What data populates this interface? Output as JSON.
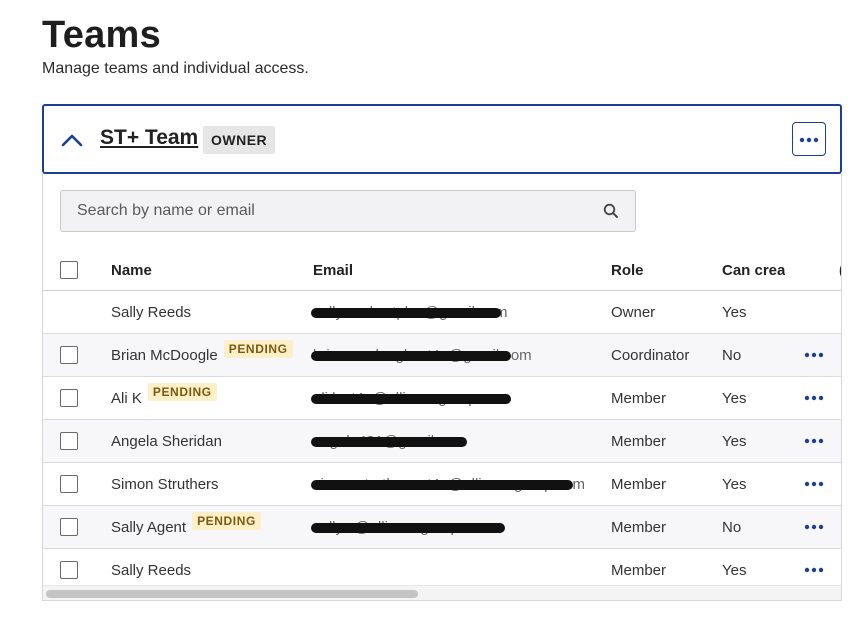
{
  "page": {
    "title": "Teams",
    "subtitle": "Manage teams and individual access."
  },
  "team": {
    "name": "ST+ Team",
    "badge": "OWNER",
    "expanded": true
  },
  "search": {
    "placeholder": "Search by name or email",
    "value": ""
  },
  "columns": [
    "Name",
    "Email",
    "Role",
    "Can crea",
    "("
  ],
  "members": [
    {
      "name": "Sally Reeds",
      "pending": "",
      "email": "sallyreeds.stplus@gmail.com",
      "role": "Owner",
      "can_create": "Yes",
      "has_checkbox": false,
      "has_menu": false
    },
    {
      "name": "Brian McDoogle",
      "pending": "PENDING",
      "email": "brian.mcdoogle.st4u@gmail.com",
      "role": "Coordinator",
      "can_create": "No",
      "has_checkbox": true,
      "has_menu": true
    },
    {
      "name": "Ali K",
      "pending": "PENDING",
      "email": "ali.k.st4u@alliancegroup.com",
      "role": "Member",
      "can_create": "Yes",
      "has_checkbox": true,
      "has_menu": true
    },
    {
      "name": "Angela Sheridan",
      "pending": "",
      "email": "angela431@gmail.com",
      "role": "Member",
      "can_create": "Yes",
      "has_checkbox": true,
      "has_menu": true
    },
    {
      "name": "Simon Struthers",
      "pending": "",
      "email": "simon.struthers.st4u@alliancegroup.com",
      "role": "Member",
      "can_create": "Yes",
      "has_checkbox": true,
      "has_menu": true
    },
    {
      "name": "Sally Agent",
      "pending": "PENDING",
      "email": "sally.a@alliancegroup.com",
      "role": "Member",
      "can_create": "No",
      "has_checkbox": true,
      "has_menu": true
    },
    {
      "name": "Sally Reeds",
      "pending": "",
      "email": "",
      "role": "Member",
      "can_create": "Yes",
      "has_checkbox": true,
      "has_menu": true
    }
  ],
  "colors": {
    "accent": "#1c3f94",
    "pending_bg": "#fdf0c8",
    "pending_text": "#7a5a0f",
    "redaction": "#111111"
  },
  "icons": {
    "collapse": "chevron-up-icon",
    "team_menu": "more-horizontal-icon",
    "search": "search-icon",
    "row_menu": "more-horizontal-icon"
  }
}
